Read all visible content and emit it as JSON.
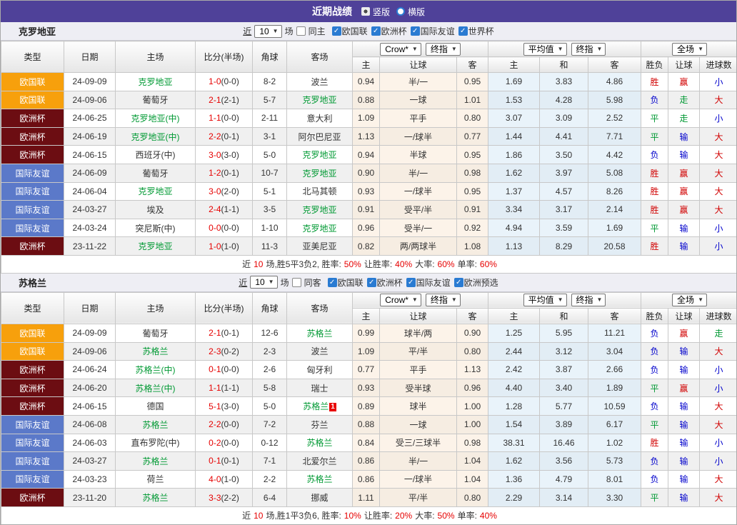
{
  "icons": {
    "checked": "✓",
    "dropdown_arrow": "▼",
    "radio_selected": "radio-selected",
    "radio_unselected": "radio-unselected"
  },
  "colors": {
    "topbar": "#4F4199",
    "type_orange": "#f7a00c",
    "type_maroon": "#6c0d12",
    "type_blue": "#5b79c9",
    "team_highlight": "#009933",
    "score_red": "#e60000",
    "win_red": "#d10000",
    "draw_green": "#009933",
    "lose_blue": "#0000cc",
    "crow_bg": "#fcf3e9",
    "avg_bg": "#e9f3fa"
  },
  "topbar": {
    "title": "近期战绩",
    "vertical": "竖版",
    "horizontal": "横版"
  },
  "columns": {
    "type": "类型",
    "date": "日期",
    "home": "主场",
    "score": "比分(半场)",
    "corner": "角球",
    "away": "客场",
    "crow_dd": "Crow*",
    "final_dd": "终指",
    "avg_dd": "平均值",
    "final_dd2": "终指",
    "full_dd": "全场",
    "crow_home": "主",
    "crow_handicap": "让球",
    "crow_away": "客",
    "avg_home": "主",
    "avg_draw": "和",
    "avg_away": "客",
    "res_wdl": "胜负",
    "res_handicap": "让球",
    "res_goals": "进球数"
  },
  "sections": [
    {
      "team": "克罗地亚",
      "filter": {
        "near": "近",
        "count": "10",
        "unit": "场",
        "same": "同主",
        "comps": [
          "欧国联",
          "欧洲杯",
          "国际友谊",
          "世界杯"
        ]
      },
      "rows": [
        {
          "type": "欧国联",
          "tc": "orange",
          "date": "24-09-09",
          "home": {
            "name": "克罗地亚",
            "hl": true
          },
          "score": "1-0",
          "half": "(0-0)",
          "corner": "8-2",
          "away": {
            "name": "波兰",
            "hl": false
          },
          "odds": [
            "0.94",
            "半/一",
            "0.95",
            "1.69",
            "3.83",
            "4.86"
          ],
          "results": [
            {
              "t": "胜",
              "c": "r"
            },
            {
              "t": "赢",
              "c": "r"
            },
            {
              "t": "小",
              "c": "b"
            }
          ]
        },
        {
          "type": "欧国联",
          "tc": "orange",
          "date": "24-09-06",
          "home": {
            "name": "葡萄牙",
            "hl": false
          },
          "score": "2-1",
          "half": "(2-1)",
          "corner": "5-7",
          "away": {
            "name": "克罗地亚",
            "hl": true
          },
          "odds": [
            "0.88",
            "一球",
            "1.01",
            "1.53",
            "4.28",
            "5.98"
          ],
          "results": [
            {
              "t": "负",
              "c": "b"
            },
            {
              "t": "走",
              "c": "g"
            },
            {
              "t": "大",
              "c": "r"
            }
          ]
        },
        {
          "type": "欧洲杯",
          "tc": "maroon",
          "date": "24-06-25",
          "home": {
            "name": "克罗地亚(中)",
            "hl": true
          },
          "score": "1-1",
          "half": "(0-0)",
          "corner": "2-11",
          "away": {
            "name": "意大利",
            "hl": false
          },
          "odds": [
            "1.09",
            "平手",
            "0.80",
            "3.07",
            "3.09",
            "2.52"
          ],
          "results": [
            {
              "t": "平",
              "c": "g"
            },
            {
              "t": "走",
              "c": "g"
            },
            {
              "t": "小",
              "c": "b"
            }
          ]
        },
        {
          "type": "欧洲杯",
          "tc": "maroon",
          "date": "24-06-19",
          "home": {
            "name": "克罗地亚(中)",
            "hl": true
          },
          "score": "2-2",
          "half": "(0-1)",
          "corner": "3-1",
          "away": {
            "name": "阿尔巴尼亚",
            "hl": false
          },
          "odds": [
            "1.13",
            "一/球半",
            "0.77",
            "1.44",
            "4.41",
            "7.71"
          ],
          "results": [
            {
              "t": "平",
              "c": "g"
            },
            {
              "t": "输",
              "c": "b"
            },
            {
              "t": "大",
              "c": "r"
            }
          ]
        },
        {
          "type": "欧洲杯",
          "tc": "maroon",
          "date": "24-06-15",
          "home": {
            "name": "西班牙(中)",
            "hl": false
          },
          "score": "3-0",
          "half": "(3-0)",
          "corner": "5-0",
          "away": {
            "name": "克罗地亚",
            "hl": true
          },
          "odds": [
            "0.94",
            "半球",
            "0.95",
            "1.86",
            "3.50",
            "4.42"
          ],
          "results": [
            {
              "t": "负",
              "c": "b"
            },
            {
              "t": "输",
              "c": "b"
            },
            {
              "t": "大",
              "c": "r"
            }
          ]
        },
        {
          "type": "国际友谊",
          "tc": "blue",
          "date": "24-06-09",
          "home": {
            "name": "葡萄牙",
            "hl": false
          },
          "score": "1-2",
          "half": "(0-1)",
          "corner": "10-7",
          "away": {
            "name": "克罗地亚",
            "hl": true
          },
          "odds": [
            "0.90",
            "半/一",
            "0.98",
            "1.62",
            "3.97",
            "5.08"
          ],
          "results": [
            {
              "t": "胜",
              "c": "r"
            },
            {
              "t": "赢",
              "c": "r"
            },
            {
              "t": "大",
              "c": "r"
            }
          ]
        },
        {
          "type": "国际友谊",
          "tc": "blue",
          "date": "24-06-04",
          "home": {
            "name": "克罗地亚",
            "hl": true
          },
          "score": "3-0",
          "half": "(2-0)",
          "corner": "5-1",
          "away": {
            "name": "北马其顿",
            "hl": false
          },
          "odds": [
            "0.93",
            "一/球半",
            "0.95",
            "1.37",
            "4.57",
            "8.26"
          ],
          "results": [
            {
              "t": "胜",
              "c": "r"
            },
            {
              "t": "赢",
              "c": "r"
            },
            {
              "t": "大",
              "c": "r"
            }
          ]
        },
        {
          "type": "国际友谊",
          "tc": "blue",
          "date": "24-03-27",
          "home": {
            "name": "埃及",
            "hl": false
          },
          "score": "2-4",
          "half": "(1-1)",
          "corner": "3-5",
          "away": {
            "name": "克罗地亚",
            "hl": true
          },
          "odds": [
            "0.91",
            "受平/半",
            "0.91",
            "3.34",
            "3.17",
            "2.14"
          ],
          "results": [
            {
              "t": "胜",
              "c": "r"
            },
            {
              "t": "赢",
              "c": "r"
            },
            {
              "t": "大",
              "c": "r"
            }
          ]
        },
        {
          "type": "国际友谊",
          "tc": "blue",
          "date": "24-03-24",
          "home": {
            "name": "突尼斯(中)",
            "hl": false
          },
          "score": "0-0",
          "half": "(0-0)",
          "corner": "1-10",
          "away": {
            "name": "克罗地亚",
            "hl": true
          },
          "odds": [
            "0.96",
            "受半/一",
            "0.92",
            "4.94",
            "3.59",
            "1.69"
          ],
          "results": [
            {
              "t": "平",
              "c": "g"
            },
            {
              "t": "输",
              "c": "b"
            },
            {
              "t": "小",
              "c": "b"
            }
          ]
        },
        {
          "type": "欧洲杯",
          "tc": "maroon",
          "date": "23-11-22",
          "home": {
            "name": "克罗地亚",
            "hl": true
          },
          "score": "1-0",
          "half": "(1-0)",
          "corner": "11-3",
          "away": {
            "name": "亚美尼亚",
            "hl": false
          },
          "odds": [
            "0.82",
            "两/两球半",
            "1.08",
            "1.13",
            "8.29",
            "20.58"
          ],
          "results": [
            {
              "t": "胜",
              "c": "r"
            },
            {
              "t": "输",
              "c": "b"
            },
            {
              "t": "小",
              "c": "b"
            }
          ]
        }
      ],
      "summary": [
        {
          "t": "近",
          "c": "k"
        },
        {
          "t": "10",
          "c": "r"
        },
        {
          "t": "场,胜5平3负2, 胜率:",
          "c": "k"
        },
        {
          "t": "50%",
          "c": "r"
        },
        {
          "t": "让胜率:",
          "c": "k"
        },
        {
          "t": "40%",
          "c": "r"
        },
        {
          "t": "大率:",
          "c": "k"
        },
        {
          "t": "60%",
          "c": "r"
        },
        {
          "t": "单率:",
          "c": "k"
        },
        {
          "t": "60%",
          "c": "r"
        }
      ]
    },
    {
      "team": "苏格兰",
      "filter": {
        "near": "近",
        "count": "10",
        "unit": "场",
        "same": "同客",
        "comps": [
          "欧国联",
          "欧洲杯",
          "国际友谊",
          "欧洲预选"
        ]
      },
      "rows": [
        {
          "type": "欧国联",
          "tc": "orange",
          "date": "24-09-09",
          "home": {
            "name": "葡萄牙",
            "hl": false
          },
          "score": "2-1",
          "half": "(0-1)",
          "corner": "12-6",
          "away": {
            "name": "苏格兰",
            "hl": true
          },
          "odds": [
            "0.99",
            "球半/两",
            "0.90",
            "1.25",
            "5.95",
            "11.21"
          ],
          "results": [
            {
              "t": "负",
              "c": "b"
            },
            {
              "t": "赢",
              "c": "r"
            },
            {
              "t": "走",
              "c": "g"
            }
          ]
        },
        {
          "type": "欧国联",
          "tc": "orange",
          "date": "24-09-06",
          "home": {
            "name": "苏格兰",
            "hl": true
          },
          "score": "2-3",
          "half": "(0-2)",
          "corner": "2-3",
          "away": {
            "name": "波兰",
            "hl": false
          },
          "odds": [
            "1.09",
            "平/半",
            "0.80",
            "2.44",
            "3.12",
            "3.04"
          ],
          "results": [
            {
              "t": "负",
              "c": "b"
            },
            {
              "t": "输",
              "c": "b"
            },
            {
              "t": "大",
              "c": "r"
            }
          ]
        },
        {
          "type": "欧洲杯",
          "tc": "maroon",
          "date": "24-06-24",
          "home": {
            "name": "苏格兰(中)",
            "hl": true
          },
          "score": "0-1",
          "half": "(0-0)",
          "corner": "2-6",
          "away": {
            "name": "匈牙利",
            "hl": false
          },
          "odds": [
            "0.77",
            "平手",
            "1.13",
            "2.42",
            "3.87",
            "2.66"
          ],
          "results": [
            {
              "t": "负",
              "c": "b"
            },
            {
              "t": "输",
              "c": "b"
            },
            {
              "t": "小",
              "c": "b"
            }
          ]
        },
        {
          "type": "欧洲杯",
          "tc": "maroon",
          "date": "24-06-20",
          "home": {
            "name": "苏格兰(中)",
            "hl": true
          },
          "score": "1-1",
          "half": "(1-1)",
          "corner": "5-8",
          "away": {
            "name": "瑞士",
            "hl": false
          },
          "odds": [
            "0.93",
            "受半球",
            "0.96",
            "4.40",
            "3.40",
            "1.89"
          ],
          "results": [
            {
              "t": "平",
              "c": "g"
            },
            {
              "t": "赢",
              "c": "r"
            },
            {
              "t": "小",
              "c": "b"
            }
          ]
        },
        {
          "type": "欧洲杯",
          "tc": "maroon",
          "date": "24-06-15",
          "home": {
            "name": "德国",
            "hl": false
          },
          "score": "5-1",
          "half": "(3-0)",
          "corner": "5-0",
          "away": {
            "name": "苏格兰",
            "hl": true,
            "badge": "1"
          },
          "odds": [
            "0.89",
            "球半",
            "1.00",
            "1.28",
            "5.77",
            "10.59"
          ],
          "results": [
            {
              "t": "负",
              "c": "b"
            },
            {
              "t": "输",
              "c": "b"
            },
            {
              "t": "大",
              "c": "r"
            }
          ]
        },
        {
          "type": "国际友谊",
          "tc": "blue",
          "date": "24-06-08",
          "home": {
            "name": "苏格兰",
            "hl": true
          },
          "score": "2-2",
          "half": "(0-0)",
          "corner": "7-2",
          "away": {
            "name": "芬兰",
            "hl": false
          },
          "odds": [
            "0.88",
            "一球",
            "1.00",
            "1.54",
            "3.89",
            "6.17"
          ],
          "results": [
            {
              "t": "平",
              "c": "g"
            },
            {
              "t": "输",
              "c": "b"
            },
            {
              "t": "大",
              "c": "r"
            }
          ]
        },
        {
          "type": "国际友谊",
          "tc": "blue",
          "date": "24-06-03",
          "home": {
            "name": "直布罗陀(中)",
            "hl": false
          },
          "score": "0-2",
          "half": "(0-0)",
          "corner": "0-12",
          "away": {
            "name": "苏格兰",
            "hl": true
          },
          "odds": [
            "0.84",
            "受三/三球半",
            "0.98",
            "38.31",
            "16.46",
            "1.02"
          ],
          "results": [
            {
              "t": "胜",
              "c": "r"
            },
            {
              "t": "输",
              "c": "b"
            },
            {
              "t": "小",
              "c": "b"
            }
          ]
        },
        {
          "type": "国际友谊",
          "tc": "blue",
          "date": "24-03-27",
          "home": {
            "name": "苏格兰",
            "hl": true
          },
          "score": "0-1",
          "half": "(0-1)",
          "corner": "7-1",
          "away": {
            "name": "北爱尔兰",
            "hl": false
          },
          "odds": [
            "0.86",
            "半/一",
            "1.04",
            "1.62",
            "3.56",
            "5.73"
          ],
          "results": [
            {
              "t": "负",
              "c": "b"
            },
            {
              "t": "输",
              "c": "b"
            },
            {
              "t": "小",
              "c": "b"
            }
          ]
        },
        {
          "type": "国际友谊",
          "tc": "blue",
          "date": "24-03-23",
          "home": {
            "name": "荷兰",
            "hl": false
          },
          "score": "4-0",
          "half": "(1-0)",
          "corner": "2-2",
          "away": {
            "name": "苏格兰",
            "hl": true
          },
          "odds": [
            "0.86",
            "一/球半",
            "1.04",
            "1.36",
            "4.79",
            "8.01"
          ],
          "results": [
            {
              "t": "负",
              "c": "b"
            },
            {
              "t": "输",
              "c": "b"
            },
            {
              "t": "大",
              "c": "r"
            }
          ]
        },
        {
          "type": "欧洲杯",
          "tc": "maroon",
          "date": "23-11-20",
          "home": {
            "name": "苏格兰",
            "hl": true
          },
          "score": "3-3",
          "half": "(2-2)",
          "corner": "6-4",
          "away": {
            "name": "挪威",
            "hl": false
          },
          "odds": [
            "1.11",
            "平/半",
            "0.80",
            "2.29",
            "3.14",
            "3.30"
          ],
          "results": [
            {
              "t": "平",
              "c": "g"
            },
            {
              "t": "输",
              "c": "b"
            },
            {
              "t": "大",
              "c": "r"
            }
          ]
        }
      ],
      "summary": [
        {
          "t": "近",
          "c": "k"
        },
        {
          "t": "10",
          "c": "r"
        },
        {
          "t": "场,胜1平3负6, 胜率:",
          "c": "k"
        },
        {
          "t": "10%",
          "c": "r"
        },
        {
          "t": "让胜率:",
          "c": "k"
        },
        {
          "t": "20%",
          "c": "r"
        },
        {
          "t": "大率:",
          "c": "k"
        },
        {
          "t": "50%",
          "c": "r"
        },
        {
          "t": "单率:",
          "c": "k"
        },
        {
          "t": "40%",
          "c": "r"
        }
      ]
    }
  ]
}
